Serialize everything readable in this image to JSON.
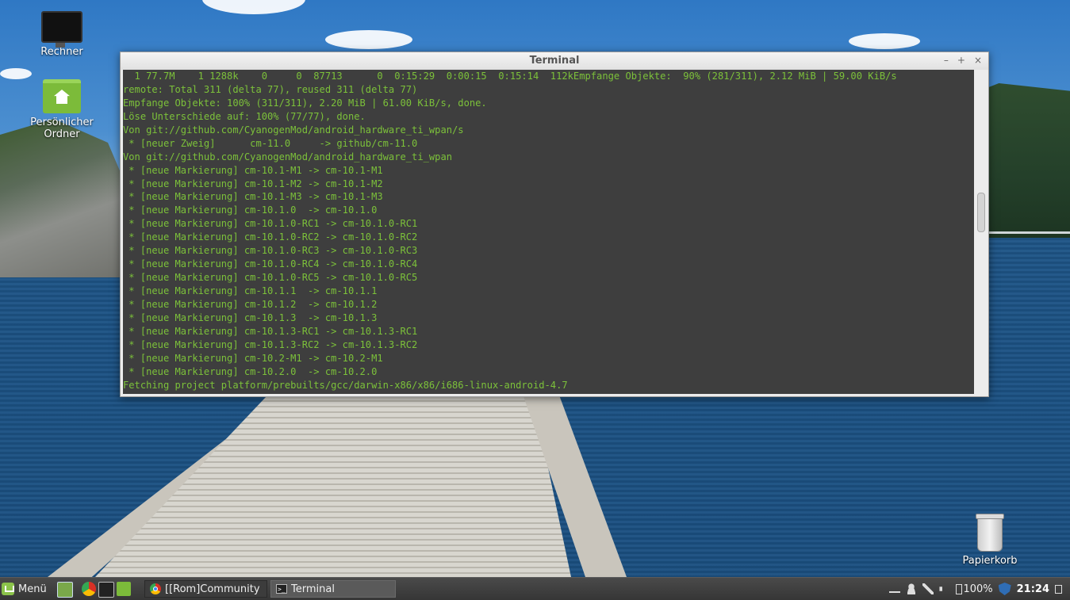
{
  "desktop": {
    "icons": [
      {
        "label": "Rechner",
        "icon": "computer-icon"
      },
      {
        "label": "Persönlicher Ordner",
        "icon": "home-folder-icon"
      },
      {
        "label": "Papierkorb",
        "icon": "trash-icon"
      }
    ]
  },
  "window": {
    "title": "Terminal",
    "buttons": {
      "minimize": "–",
      "maximize": "+",
      "close": "×"
    },
    "lines": [
      "  1 77.7M    1 1288k    0     0  87713      0  0:15:29  0:00:15  0:15:14  112kEmpfange Objekte:  90% (281/311), 2.12 MiB | 59.00 KiB/s",
      "remote: Total 311 (delta 77), reused 311 (delta 77)",
      "Empfange Objekte: 100% (311/311), 2.20 MiB | 61.00 KiB/s, done.",
      "Löse Unterschiede auf: 100% (77/77), done.",
      "Von git://github.com/CyanogenMod/android_hardware_ti_wpan/s",
      " * [neuer Zweig]      cm-11.0     -> github/cm-11.0",
      "Von git://github.com/CyanogenMod/android_hardware_ti_wpan",
      " * [neue Markierung] cm-10.1-M1 -> cm-10.1-M1",
      " * [neue Markierung] cm-10.1-M2 -> cm-10.1-M2",
      " * [neue Markierung] cm-10.1-M3 -> cm-10.1-M3",
      " * [neue Markierung] cm-10.1.0  -> cm-10.1.0",
      " * [neue Markierung] cm-10.1.0-RC1 -> cm-10.1.0-RC1",
      " * [neue Markierung] cm-10.1.0-RC2 -> cm-10.1.0-RC2",
      " * [neue Markierung] cm-10.1.0-RC3 -> cm-10.1.0-RC3",
      " * [neue Markierung] cm-10.1.0-RC4 -> cm-10.1.0-RC4",
      " * [neue Markierung] cm-10.1.0-RC5 -> cm-10.1.0-RC5",
      " * [neue Markierung] cm-10.1.1  -> cm-10.1.1",
      " * [neue Markierung] cm-10.1.2  -> cm-10.1.2",
      " * [neue Markierung] cm-10.1.3  -> cm-10.1.3",
      " * [neue Markierung] cm-10.1.3-RC1 -> cm-10.1.3-RC1",
      " * [neue Markierung] cm-10.1.3-RC2 -> cm-10.1.3-RC2",
      " * [neue Markierung] cm-10.2-M1 -> cm-10.2-M1",
      " * [neue Markierung] cm-10.2.0  -> cm-10.2.0",
      "Fetching project platform/prebuilts/gcc/darwin-x86/x86/i686-linux-android-4.7"
    ]
  },
  "taskbar": {
    "menu_label": "Menü",
    "quick_launch": [
      "show-desktop-icon",
      "chrome-icon",
      "terminal-icon",
      "file-manager-icon"
    ],
    "tasks": [
      {
        "label": "[[Rom]Community ...",
        "icon": "chrome-icon"
      },
      {
        "label": "Terminal",
        "icon": "terminal-icon"
      }
    ],
    "tray": {
      "battery": "100%",
      "clock": "21:24"
    }
  },
  "colors": {
    "terminal_bg": "#3e3e3e",
    "terminal_text": "#7cc13a",
    "taskbar_bg": "#3c3c3c",
    "accent": "#8bc34a"
  }
}
